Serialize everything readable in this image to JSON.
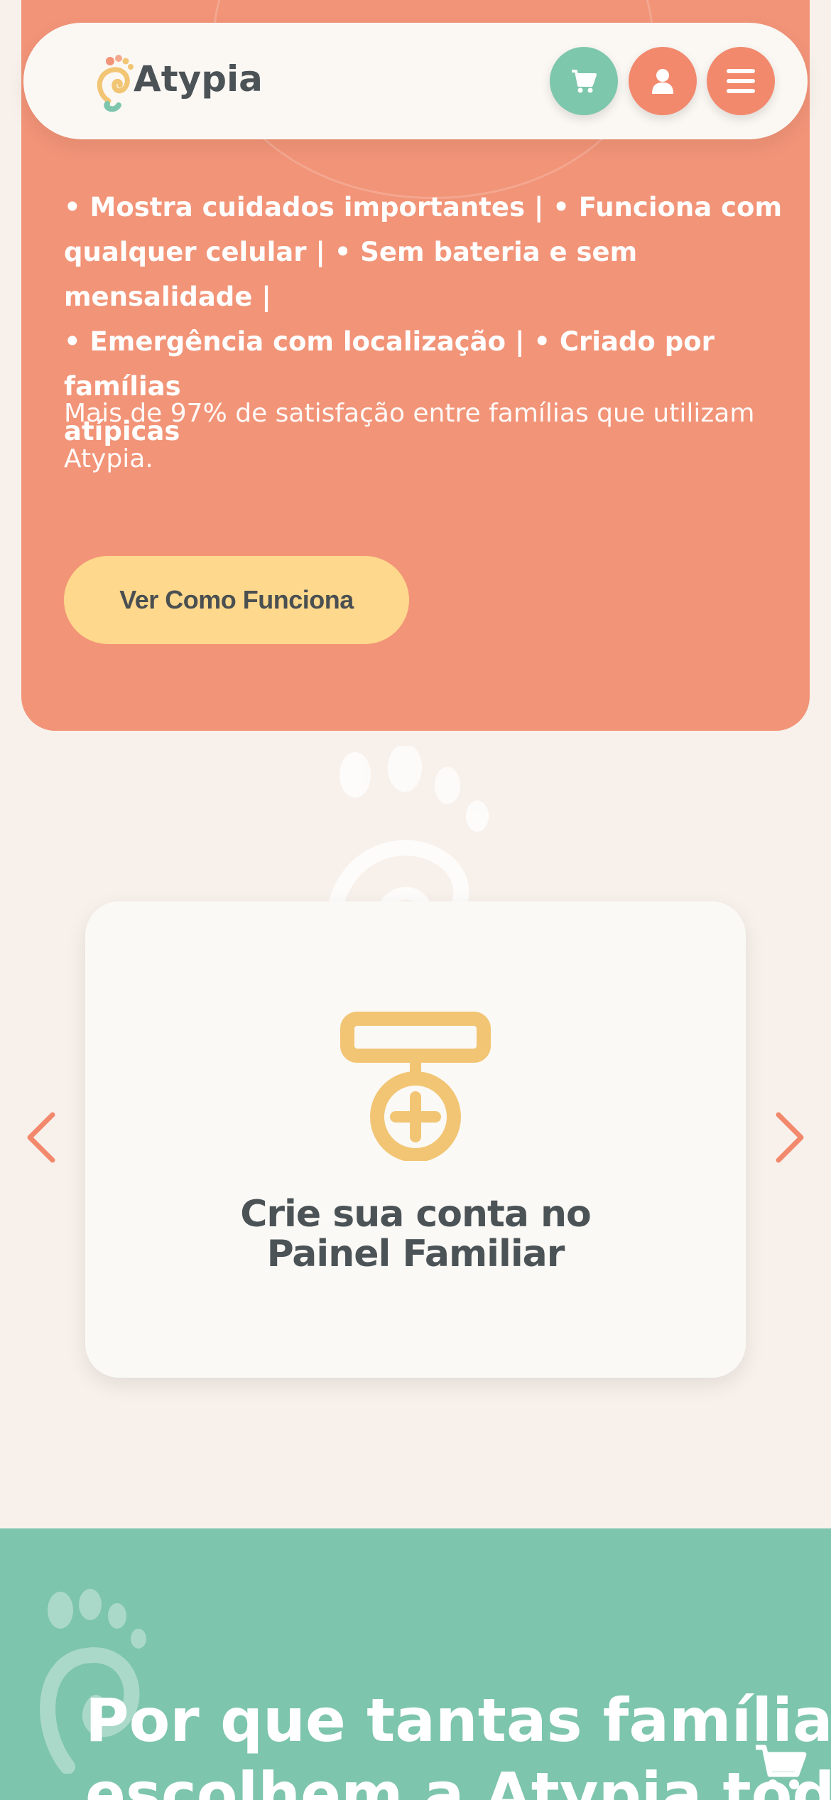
{
  "header": {
    "brand": "Atypia",
    "cart_icon": "cart-icon",
    "user_icon": "user-icon",
    "menu_icon": "hamburger-menu-icon"
  },
  "hero": {
    "features_line_1": "• Mostra cuidados importantes | • Funciona com",
    "features_line_2": "qualquer celular | • Sem bateria e sem mensalidade |",
    "features_line_3": "• Emergência com localização | • Criado por famílias",
    "features_line_4": "atípicas",
    "satisfaction": "Mais de 97% de satisfação entre famílias que utilizam Atypia.",
    "cta_label": "Ver Como Funciona"
  },
  "carousel": {
    "prev_icon": "chevron-left-icon",
    "next_icon": "chevron-right-icon",
    "step_icon": "medical-badge-icon",
    "step_title": "Crie sua conta no Painel Familiar"
  },
  "why_section": {
    "title_line_1": "Por que tantas famílias",
    "title_line_2": "escolhem a Atypia todo"
  },
  "colors": {
    "background": "#f8f1eb",
    "hero_orange": "#f29478",
    "cta_yellow": "#fed88c",
    "accent_green": "#7dc5ac",
    "icon_yellow": "#f2c574",
    "text_dark": "#4c5357"
  }
}
